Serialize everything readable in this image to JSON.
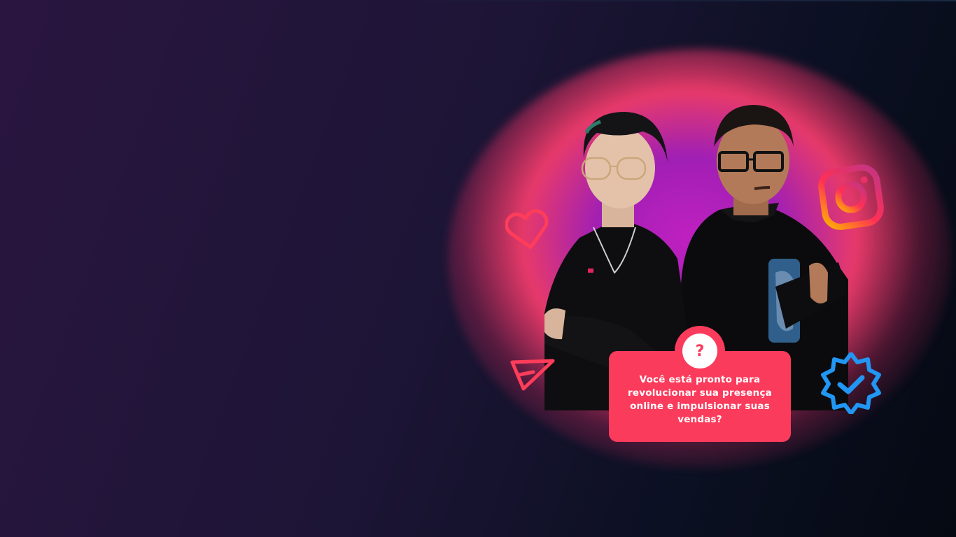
{
  "hero": {
    "question_mark": "?",
    "callout_text": "Você está pronto para revolucionar sua presença online e impulsionar suas vendas?"
  },
  "icons": [
    "heart-icon",
    "send-icon",
    "instagram-icon",
    "verified-badge-icon",
    "question-icon"
  ],
  "colors": {
    "accent": "#fb3b5c",
    "verified_blue": "#2196f3",
    "background_left": "#2a1540",
    "background_right": "#050912"
  }
}
